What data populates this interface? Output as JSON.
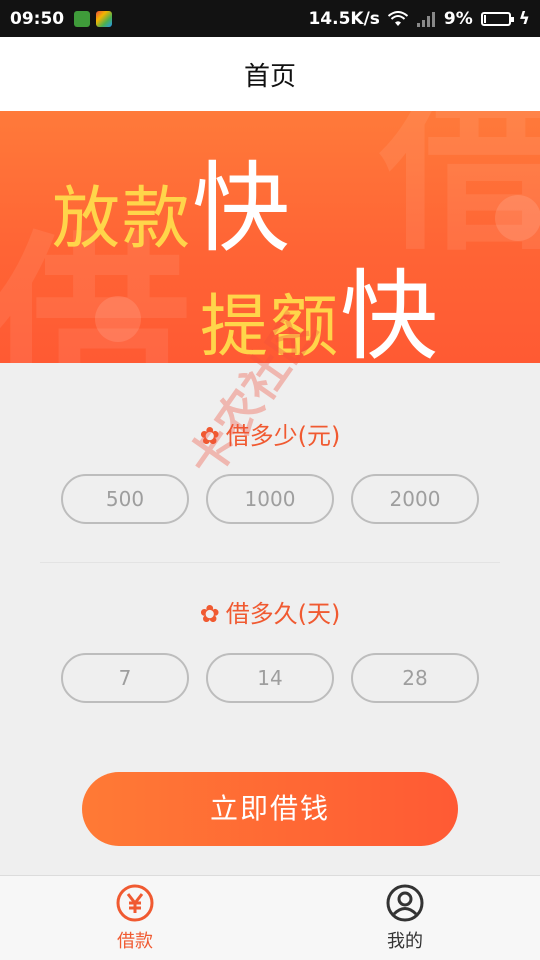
{
  "status_bar": {
    "time": "09:50",
    "net_speed": "14.5K/s",
    "battery_percent": "9%",
    "battery_level": 0.09
  },
  "title_bar": {
    "title": "首页"
  },
  "banner": {
    "line1_soft": "放款",
    "line1_hard": "快",
    "line2_soft": "提额",
    "line2_hard": "快",
    "ghost_text": "借"
  },
  "amount_section": {
    "title": "借多少(元)",
    "options": [
      "500",
      "1000",
      "2000"
    ]
  },
  "duration_section": {
    "title": "借多久(天)",
    "options": [
      "7",
      "14",
      "28"
    ]
  },
  "cta": {
    "label": "立即借钱"
  },
  "tabs": [
    {
      "label": "借款",
      "icon": "yen-circle-icon"
    },
    {
      "label": "我的",
      "icon": "user-circle-icon"
    }
  ],
  "watermark": {
    "text": "卡农社区"
  },
  "colors": {
    "accent": "#f05a31",
    "banner": "#ff6435",
    "yellow_text": "#ffd54a",
    "option_border": "#bdbdbd"
  }
}
